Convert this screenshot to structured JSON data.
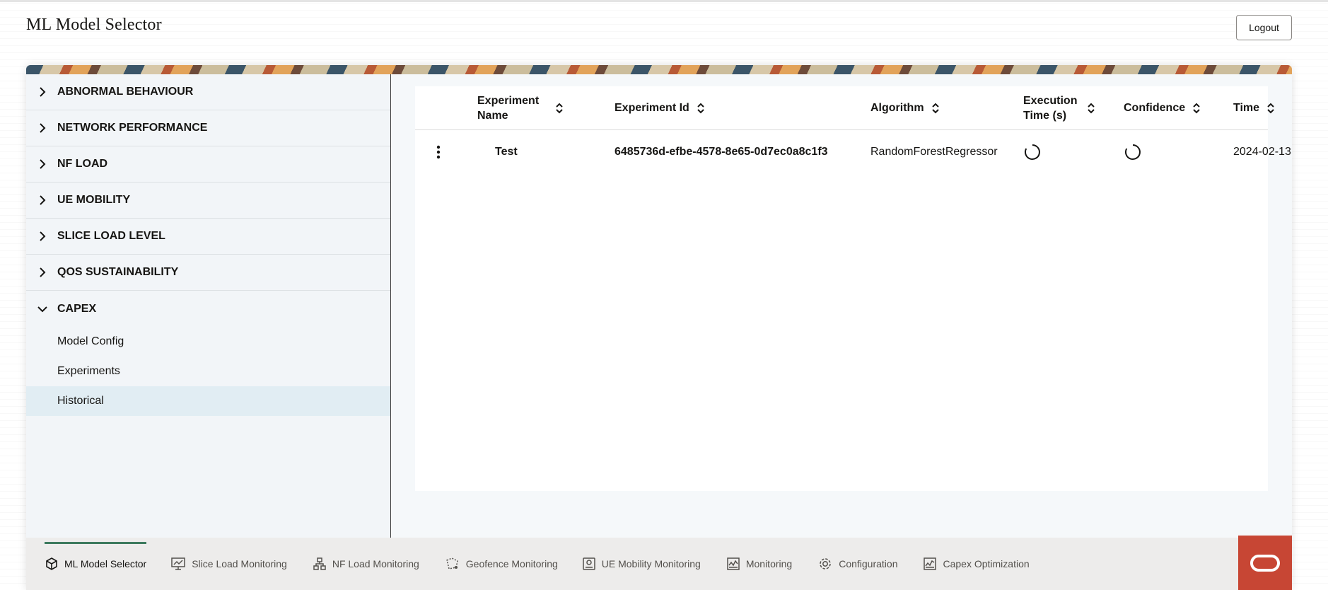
{
  "app": {
    "title": "ML Model Selector",
    "logout_label": "Logout"
  },
  "sidebar": {
    "sections": [
      {
        "label": "ABNORMAL BEHAVIOUR",
        "expanded": false
      },
      {
        "label": "NETWORK PERFORMANCE",
        "expanded": false
      },
      {
        "label": "NF LOAD",
        "expanded": false
      },
      {
        "label": "UE MOBILITY",
        "expanded": false
      },
      {
        "label": "SLICE LOAD LEVEL",
        "expanded": false
      },
      {
        "label": "QOS SUSTAINABILITY",
        "expanded": false
      },
      {
        "label": "CAPEX",
        "expanded": true
      }
    ],
    "capex_items": [
      {
        "label": "Model Config"
      },
      {
        "label": "Experiments"
      },
      {
        "label": "Historical",
        "selected": true
      }
    ]
  },
  "table": {
    "columns": [
      "Experiment Name",
      "Experiment Id",
      "Algorithm",
      "Execution Time (s)",
      "Confidence",
      "Time"
    ],
    "rows": [
      {
        "name": "Test",
        "id": "6485736d-efbe-4578-8e65-0d7ec0a8c1f3",
        "algorithm": "RandomForestRegressor",
        "execution_time_icon": "loading-spinner-icon",
        "confidence_icon": "loading-spinner-icon",
        "time": "2024-02-13"
      }
    ]
  },
  "footer_tabs": [
    {
      "label": "ML Model Selector",
      "icon": "model-selector-icon",
      "active": true
    },
    {
      "label": "Slice Load Monitoring",
      "icon": "monitor-chart-icon"
    },
    {
      "label": "NF Load Monitoring",
      "icon": "network-hierarchy-icon"
    },
    {
      "label": "Geofence Monitoring",
      "icon": "geofence-icon"
    },
    {
      "label": "UE Mobility Monitoring",
      "icon": "device-icon"
    },
    {
      "label": "Monitoring",
      "icon": "activity-chart-icon"
    },
    {
      "label": "Configuration",
      "icon": "gear-icon"
    },
    {
      "label": "Capex Optimization",
      "icon": "capex-chart-icon"
    }
  ],
  "colors": {
    "accent_active_tab": "#3d7a5e",
    "oracle_red": "#c74634",
    "selected_item_bg": "#e1edf3"
  }
}
